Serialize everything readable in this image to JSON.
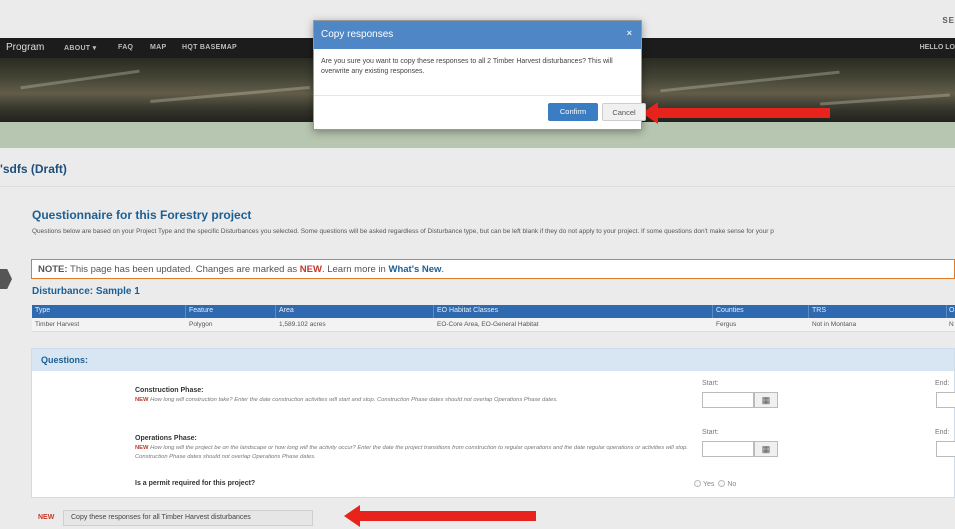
{
  "topbar": {
    "right_text": "SE"
  },
  "navbar": {
    "brand": "Program",
    "items": [
      "ABOUT ▾",
      "FAQ",
      "MAP",
      "HQT BASEMAP"
    ],
    "hello": "HELLO LO"
  },
  "project": {
    "title": "'sdfs (Draft)"
  },
  "questionnaire": {
    "title": "Questionnaire for this Forestry project",
    "description": "Questions below are based on your Project Type and the specific Disturbances you selected. Some questions will be asked regardless of Disturbance type, but can be left blank if they do not apply to your project. If some questions don't make sense for your p"
  },
  "notice": {
    "prefix": "NOTE:",
    "text1": " This page has been updated. Changes are marked as ",
    "new_word": "NEW",
    "text2": ". Learn more in ",
    "link": "What's New",
    "end": "."
  },
  "disturbance": {
    "title": "Disturbance: Sample 1",
    "columns": [
      "Type",
      "Feature",
      "Area",
      "EO Habitat Classes",
      "Counties",
      "TRS",
      "O"
    ],
    "row": [
      "Timber Harvest",
      "Polygon",
      "1,589.102 acres",
      "EO-Core Area, EO-General Habitat",
      "Fergus",
      "Not in Montana",
      "N"
    ]
  },
  "questions": {
    "header": "Questions:",
    "construction": {
      "label": "Construction Phase:",
      "new": "NEW",
      "text": " How long will construction take? Enter the date construction activities will start and stop. Construction Phase dates should not overlap Operations Phase dates.",
      "start_label": "Start:",
      "end_label": "End:"
    },
    "operations": {
      "label": "Operations Phase:",
      "new": "NEW",
      "text": " How long will the project be on the landscape or how long will the activity occur? Enter the date the project transitions from construction to regular operations and the date regular operations or activities will stop. Construction Phase dates should not overlap Operations Phase dates.",
      "start_label": "Start:",
      "end_label": "End:"
    },
    "permit": {
      "label": "Is a permit required for this project?",
      "yes": "Yes",
      "no": "No"
    }
  },
  "copy_bar": {
    "new": "NEW",
    "button": "Copy these responses for all Timber Harvest disturbances"
  },
  "modal": {
    "title": "Copy responses",
    "close": "×",
    "body": "Are you sure you want to copy these responses to all 2 Timber Harvest disturbances? This will overwrite any existing responses.",
    "confirm": "Confirm",
    "cancel": "Cancel"
  },
  "colors": {
    "accent_blue": "#2f6ab0",
    "modal_header": "#4f86c6",
    "new_red": "#c0392b",
    "arrow_red": "#e8231b",
    "notice_border": "#e07b2a"
  }
}
